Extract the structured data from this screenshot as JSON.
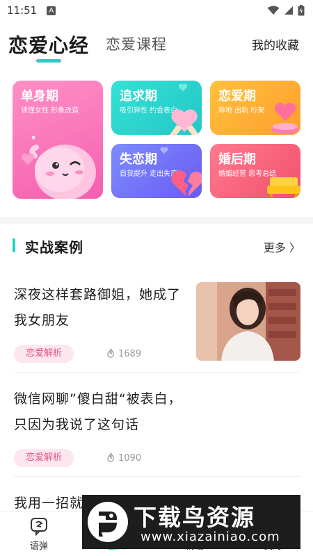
{
  "status_bar": {
    "time": "11:51",
    "notification_badge": "A",
    "icons": [
      "wifi-icon",
      "signal-icon",
      "battery-icon"
    ]
  },
  "header": {
    "active_tab": "恋爱心经",
    "inactive_tab": "恋爱课程",
    "favorites_label": "我的收藏",
    "accent_color": "#22d3c5"
  },
  "stage_cards": [
    {
      "title": "单身期",
      "subtitle": "读懂女性 形象改造",
      "color": "#f45fb0"
    },
    {
      "title": "追求期",
      "subtitle": "吸引异性 约会表白",
      "color": "#22c8c8"
    },
    {
      "title": "恋爱期",
      "subtitle": "异地 出轨 吵架",
      "color": "#ff9d2e"
    },
    {
      "title": "失恋期",
      "subtitle": "自我提升 走出失恋",
      "color": "#6a5bf0"
    },
    {
      "title": "婚后期",
      "subtitle": "婚姻经营 思考总结",
      "color": "#f2506c"
    }
  ],
  "section": {
    "title": "实战案例",
    "more_label": "更多 〉"
  },
  "articles": [
    {
      "title": "深夜这样套路御姐，她成了我女朋友",
      "tag": "恋爱解析",
      "views": "1689",
      "has_thumbnail": true
    },
    {
      "title": "微信网聊”傻白甜“被表白，只因为我说了这句话",
      "tag": "恋爱解析",
      "views": "1090",
      "has_thumbnail": false
    },
    {
      "title": "我用一招就",
      "tag": "",
      "views": "",
      "has_thumbnail": false
    }
  ],
  "bottom_nav": [
    {
      "label": "语弹",
      "icon": "chat-bubble-icon"
    },
    {
      "label": "宝典",
      "icon": "book-icon"
    },
    {
      "label": "情话",
      "icon": "heart-icon"
    },
    {
      "label": "我的",
      "icon": "user-icon"
    }
  ],
  "watermark": {
    "brand": "下载鸟资源",
    "url": "www.xiazainiao.com"
  }
}
